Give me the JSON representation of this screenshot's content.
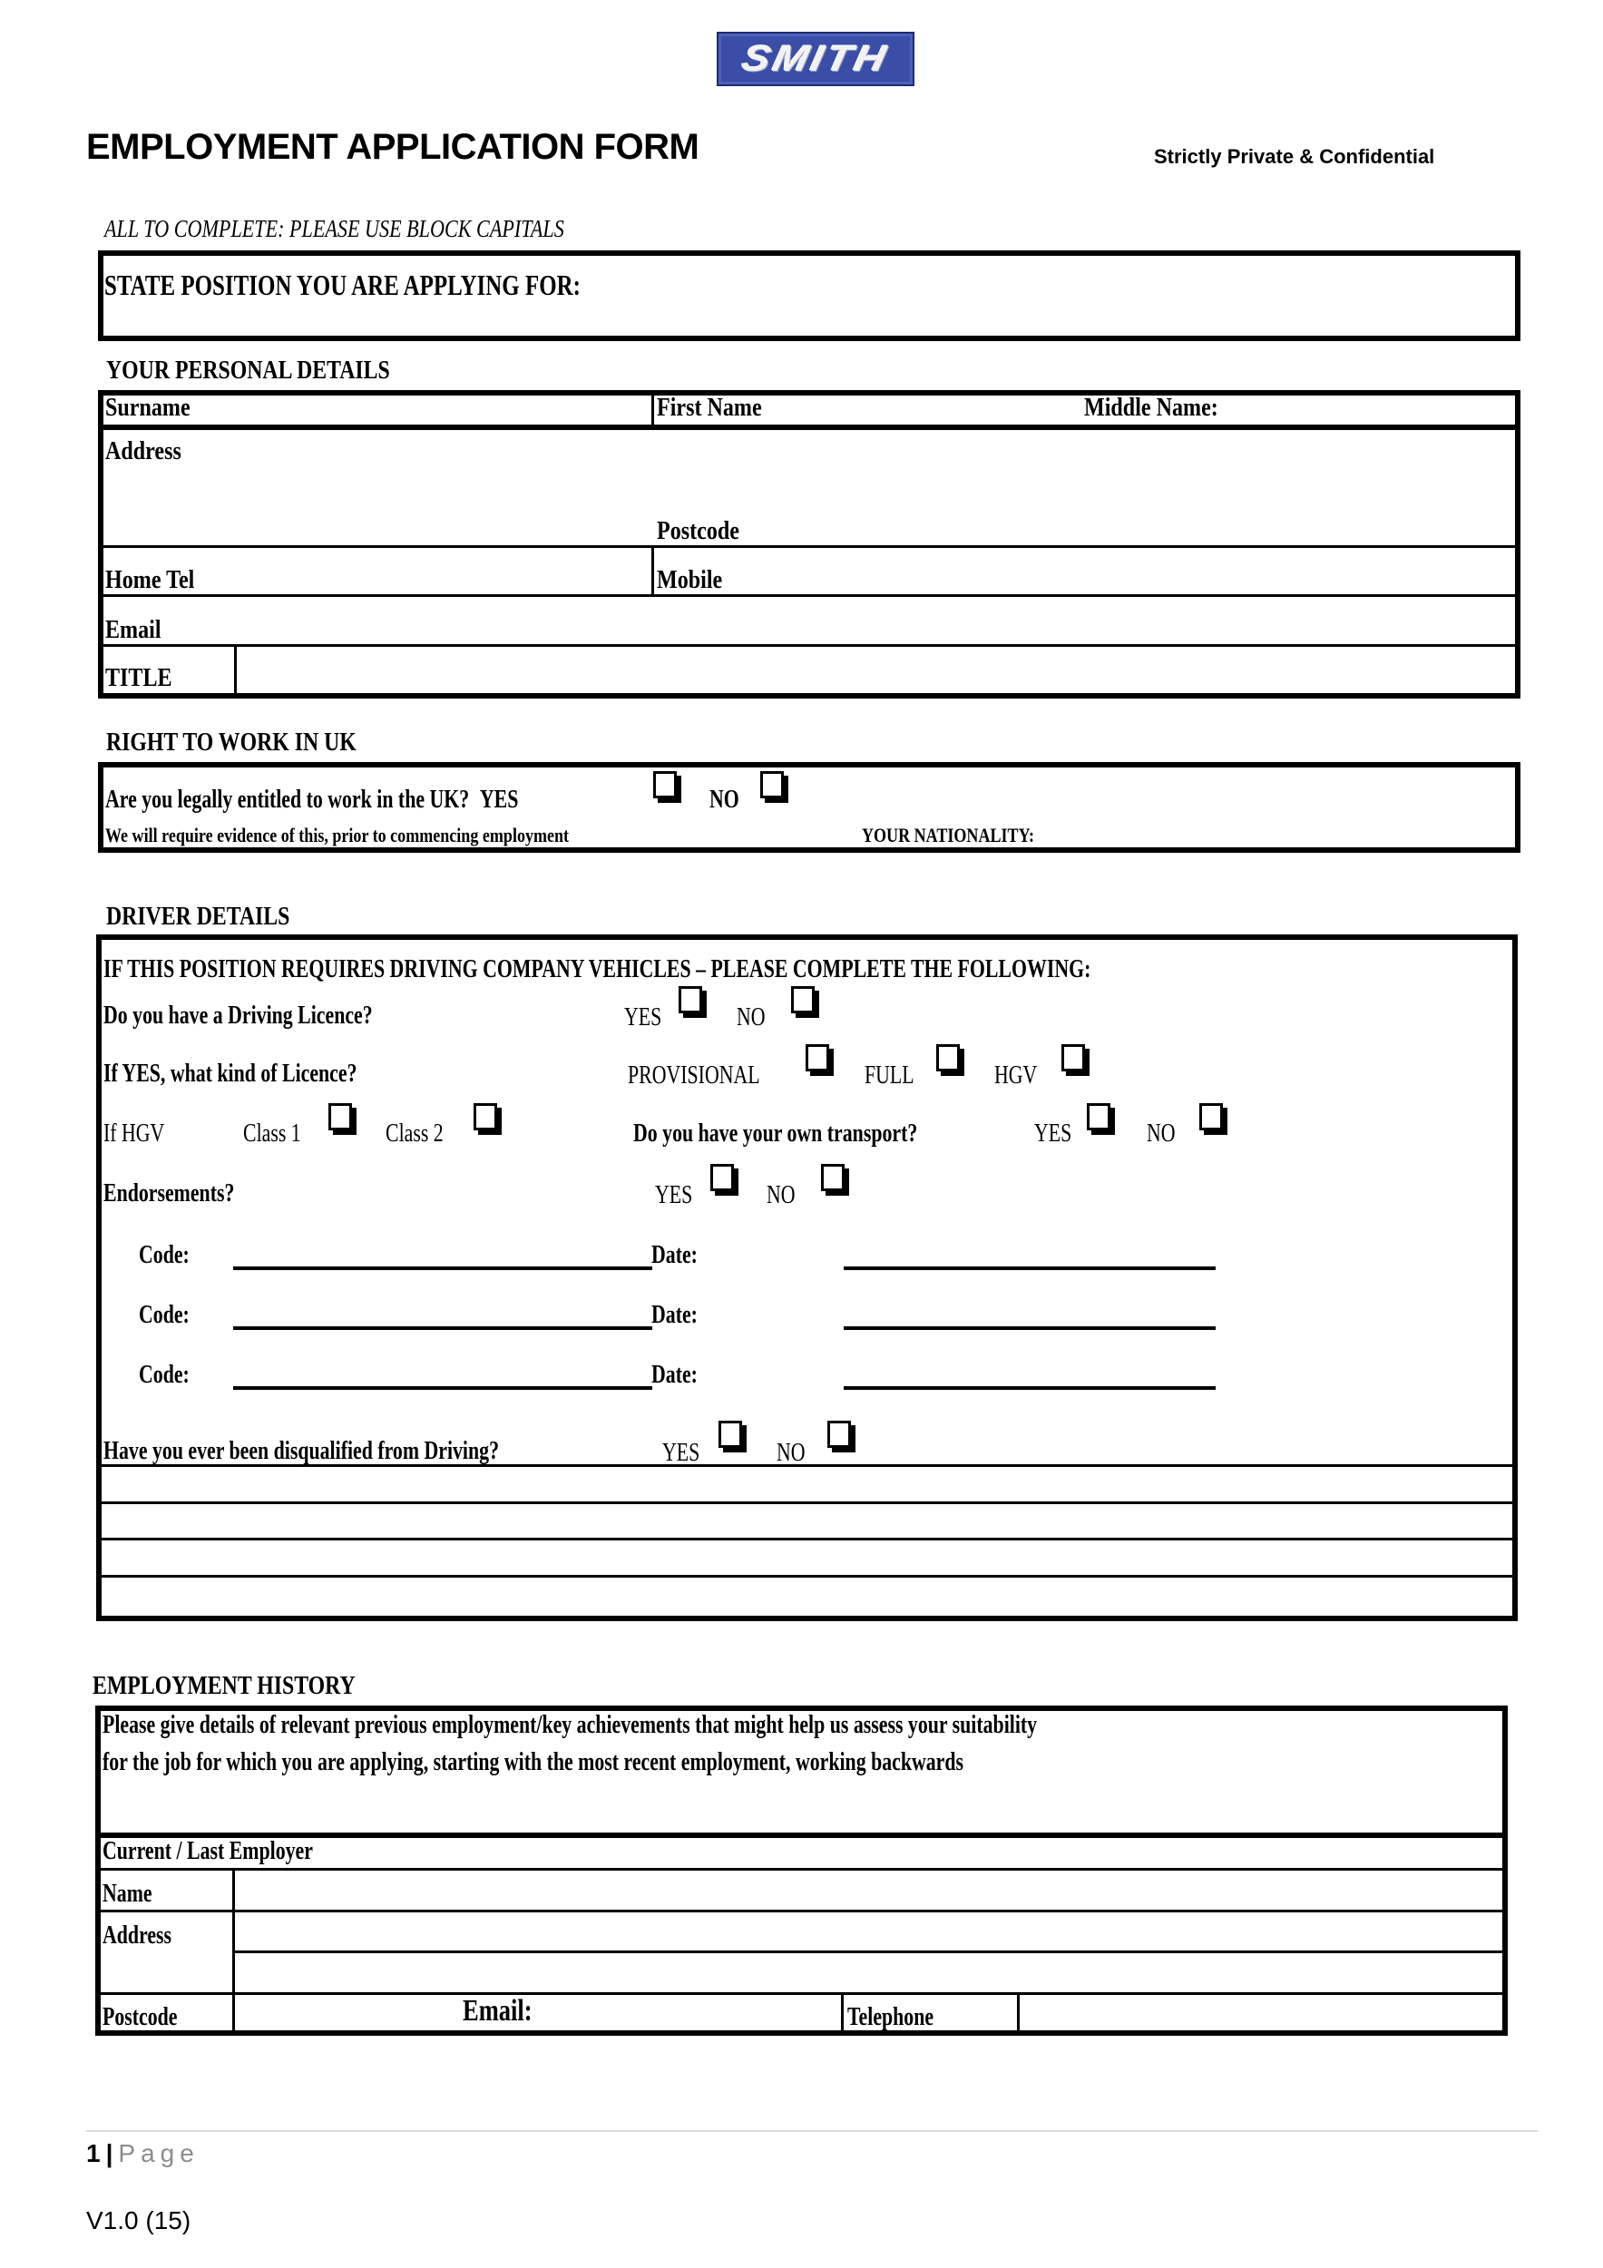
{
  "header": {
    "logo_text": "SMITH",
    "logo_color": "#3a4ea8",
    "title": "EMPLOYMENT APPLICATION FORM",
    "confidential": "Strictly Private & Confidential",
    "instruction": "ALL TO COMPLETE: PLEASE USE BLOCK CAPITALS"
  },
  "position": {
    "label": "STATE POSITION YOU ARE APPLYING FOR:",
    "value": ""
  },
  "personal": {
    "heading": "YOUR PERSONAL DETAILS",
    "surname": "Surname",
    "first_name": "First Name",
    "middle_name": "Middle Name:",
    "address": "Address",
    "postcode": "Postcode",
    "home_tel": "Home Tel",
    "mobile": "Mobile",
    "email": "Email",
    "title": "TITLE"
  },
  "right_to_work": {
    "heading": "RIGHT TO WORK IN UK",
    "question": "Are you legally entitled to work in the UK?",
    "yes": "YES",
    "no": "NO",
    "note": "We will require evidence of this, prior to commencing employment",
    "nationality": "YOUR NATIONALITY:"
  },
  "driver": {
    "heading": "DRIVER DETAILS",
    "intro": "IF THIS POSITION REQUIRES DRIVING COMPANY VEHICLES – PLEASE COMPLETE THE FOLLOWING:",
    "licence_q": "Do you have a Driving Licence?",
    "licence_kind_q": "If YES, what kind of Licence?",
    "provisional": "PROVISIONAL",
    "full": "FULL",
    "hgv": "HGV",
    "if_hgv": "If HGV",
    "class1": "Class 1",
    "class2": "Class 2",
    "transport_q": "Do you have your own transport?",
    "endorsements_q": "Endorsements?",
    "yes": "YES",
    "no": "NO",
    "code_label": "Code:",
    "date_label": "Date:",
    "endorsement_rows": [
      {
        "code": "",
        "date": ""
      },
      {
        "code": "",
        "date": ""
      },
      {
        "code": "",
        "date": ""
      }
    ],
    "disqualified_q": "Have you ever been disqualified from Driving?"
  },
  "employment": {
    "heading": "EMPLOYMENT HISTORY",
    "intro_line1": "Please give details of relevant previous employment/key achievements that might help us assess your suitability",
    "intro_line2": "for the job for which you are applying, starting with the most recent employment, working backwards",
    "current_last": "Current / Last Employer",
    "name": "Name",
    "address": "Address",
    "postcode": "Postcode",
    "email": "Email:",
    "telephone": "Telephone"
  },
  "footer": {
    "page_number": "1",
    "separator": "|",
    "page_word": "Page",
    "version": "V1.0 (15)"
  }
}
